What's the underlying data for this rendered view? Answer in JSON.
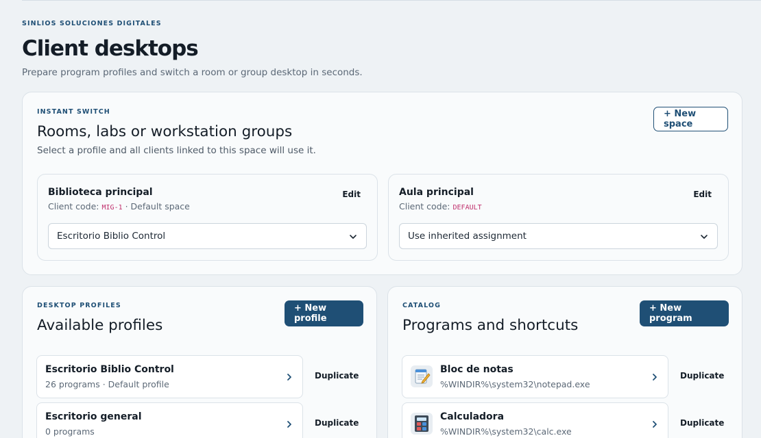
{
  "header": {
    "brand": "SINLIOS SOLUCIONES DIGITALES",
    "title": "Client desktops",
    "subtitle": "Prepare program profiles and switch a room or group desktop in seconds."
  },
  "instant_switch": {
    "eyebrow": "INSTANT SWITCH",
    "title": "Rooms, labs or workstation groups",
    "description": "Select a profile and all clients linked to this space will use it.",
    "new_button": "+ New space",
    "spaces": [
      {
        "name": "Biblioteca principal",
        "code_label": "Client code:",
        "code": "MIG-1",
        "extra": " · Default space",
        "edit": "Edit",
        "selected": "Escritorio Biblio Control"
      },
      {
        "name": "Aula principal",
        "code_label": "Client code:",
        "code": "DEFAULT",
        "extra": "",
        "edit": "Edit",
        "selected": "Use inherited assignment"
      }
    ]
  },
  "profiles": {
    "eyebrow": "DESKTOP PROFILES",
    "title": "Available profiles",
    "new_button": "+ New profile",
    "items": [
      {
        "name": "Escritorio Biblio Control",
        "meta": "26 programs · Default profile",
        "action": "Duplicate"
      },
      {
        "name": "Escritorio general",
        "meta": "0 programs",
        "action": "Duplicate"
      }
    ]
  },
  "catalog": {
    "eyebrow": "CATALOG",
    "title": "Programs and shortcuts",
    "new_button": "+ New program",
    "items": [
      {
        "name": "Bloc de notas",
        "path": "%WINDIR%\\system32\\notepad.exe",
        "icon": "notepad-icon",
        "action": "Duplicate"
      },
      {
        "name": "Calculadora",
        "path": "%WINDIR%\\system32\\calc.exe",
        "icon": "calculator-icon",
        "action": "Duplicate"
      }
    ]
  },
  "colors": {
    "accent": "#1f4f75",
    "background": "#eef2f5",
    "code": "#c0306d"
  }
}
